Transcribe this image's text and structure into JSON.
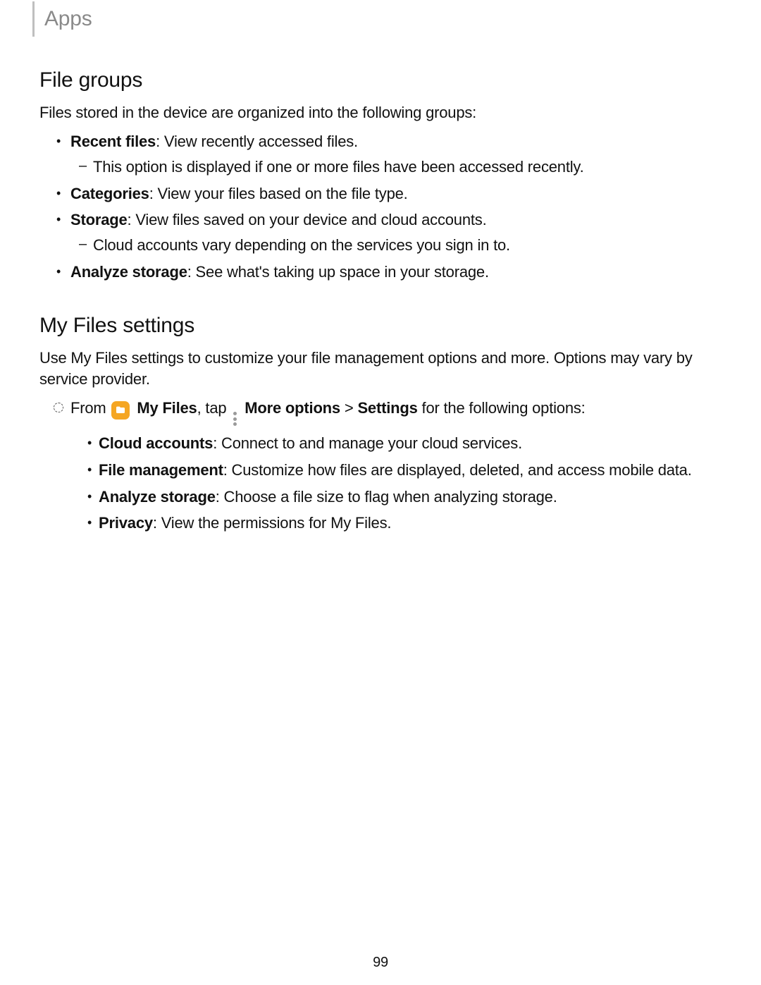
{
  "header": {
    "breadcrumb": "Apps"
  },
  "section1": {
    "title": "File groups",
    "intro": "Files stored in the device are organized into the following groups:",
    "items": {
      "recent": {
        "label": "Recent files",
        "desc": ": View recently accessed files.",
        "sub": "This option is displayed if one or more files have been accessed recently."
      },
      "categories": {
        "label": "Categories",
        "desc": ": View your files based on the file type."
      },
      "storage": {
        "label": "Storage",
        "desc": ": View files saved on your device and cloud accounts.",
        "sub": "Cloud accounts vary depending on the services you sign in to."
      },
      "analyze": {
        "label": "Analyze storage",
        "desc": ": See what's taking up space in your storage."
      }
    }
  },
  "section2": {
    "title": "My Files settings",
    "intro": "Use My Files settings to customize your file management options and more. Options may vary by service provider.",
    "step": {
      "pre": "From ",
      "app": "My Files",
      "mid1": ", tap ",
      "more": "More options",
      "gt": " > ",
      "settings": "Settings",
      "post": " for the following options:"
    },
    "items": {
      "cloud": {
        "label": "Cloud accounts",
        "desc": ": Connect to and manage your cloud services."
      },
      "filemgmt": {
        "label": "File management",
        "desc": ": Customize how files are displayed, deleted, and access mobile data."
      },
      "analyze": {
        "label": "Analyze storage",
        "desc": ": Choose a file size to flag when analyzing storage."
      },
      "privacy": {
        "label": "Privacy",
        "desc": ": View the permissions for My Files."
      }
    }
  },
  "page_number": "99"
}
